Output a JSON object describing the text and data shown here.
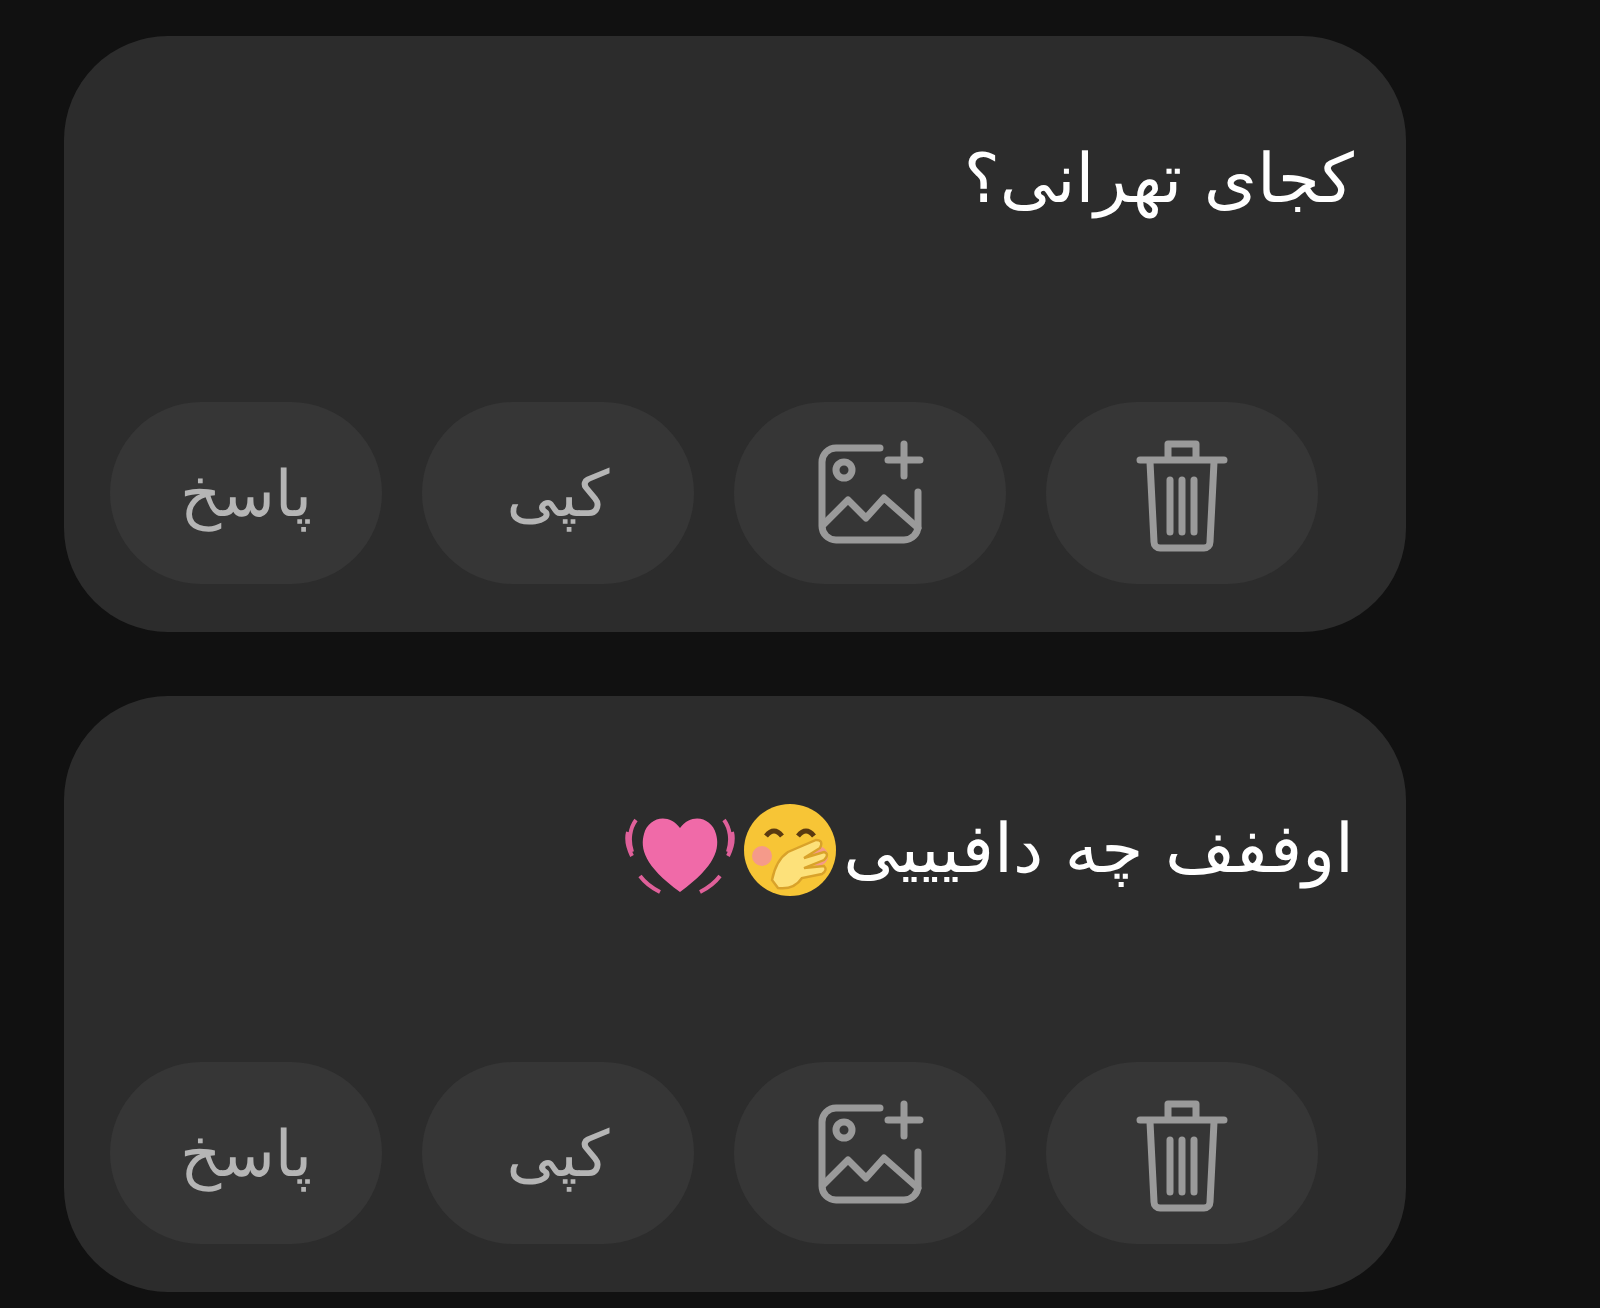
{
  "messages": [
    {
      "text": "کجای تهرانی؟",
      "actions": [
        {
          "kind": "delete"
        },
        {
          "kind": "add-image"
        },
        {
          "kind": "copy",
          "label": "کپی"
        },
        {
          "kind": "reply",
          "label": "پاسخ"
        }
      ]
    },
    {
      "text": "اوففف چه دافیییی",
      "emoji_icons": [
        {
          "kind": "face-hand"
        },
        {
          "kind": "heart"
        }
      ],
      "actions": [
        {
          "kind": "delete"
        },
        {
          "kind": "add-image"
        },
        {
          "kind": "copy",
          "label": "کپی"
        },
        {
          "kind": "reply",
          "label": "پاسخ"
        }
      ]
    }
  ]
}
